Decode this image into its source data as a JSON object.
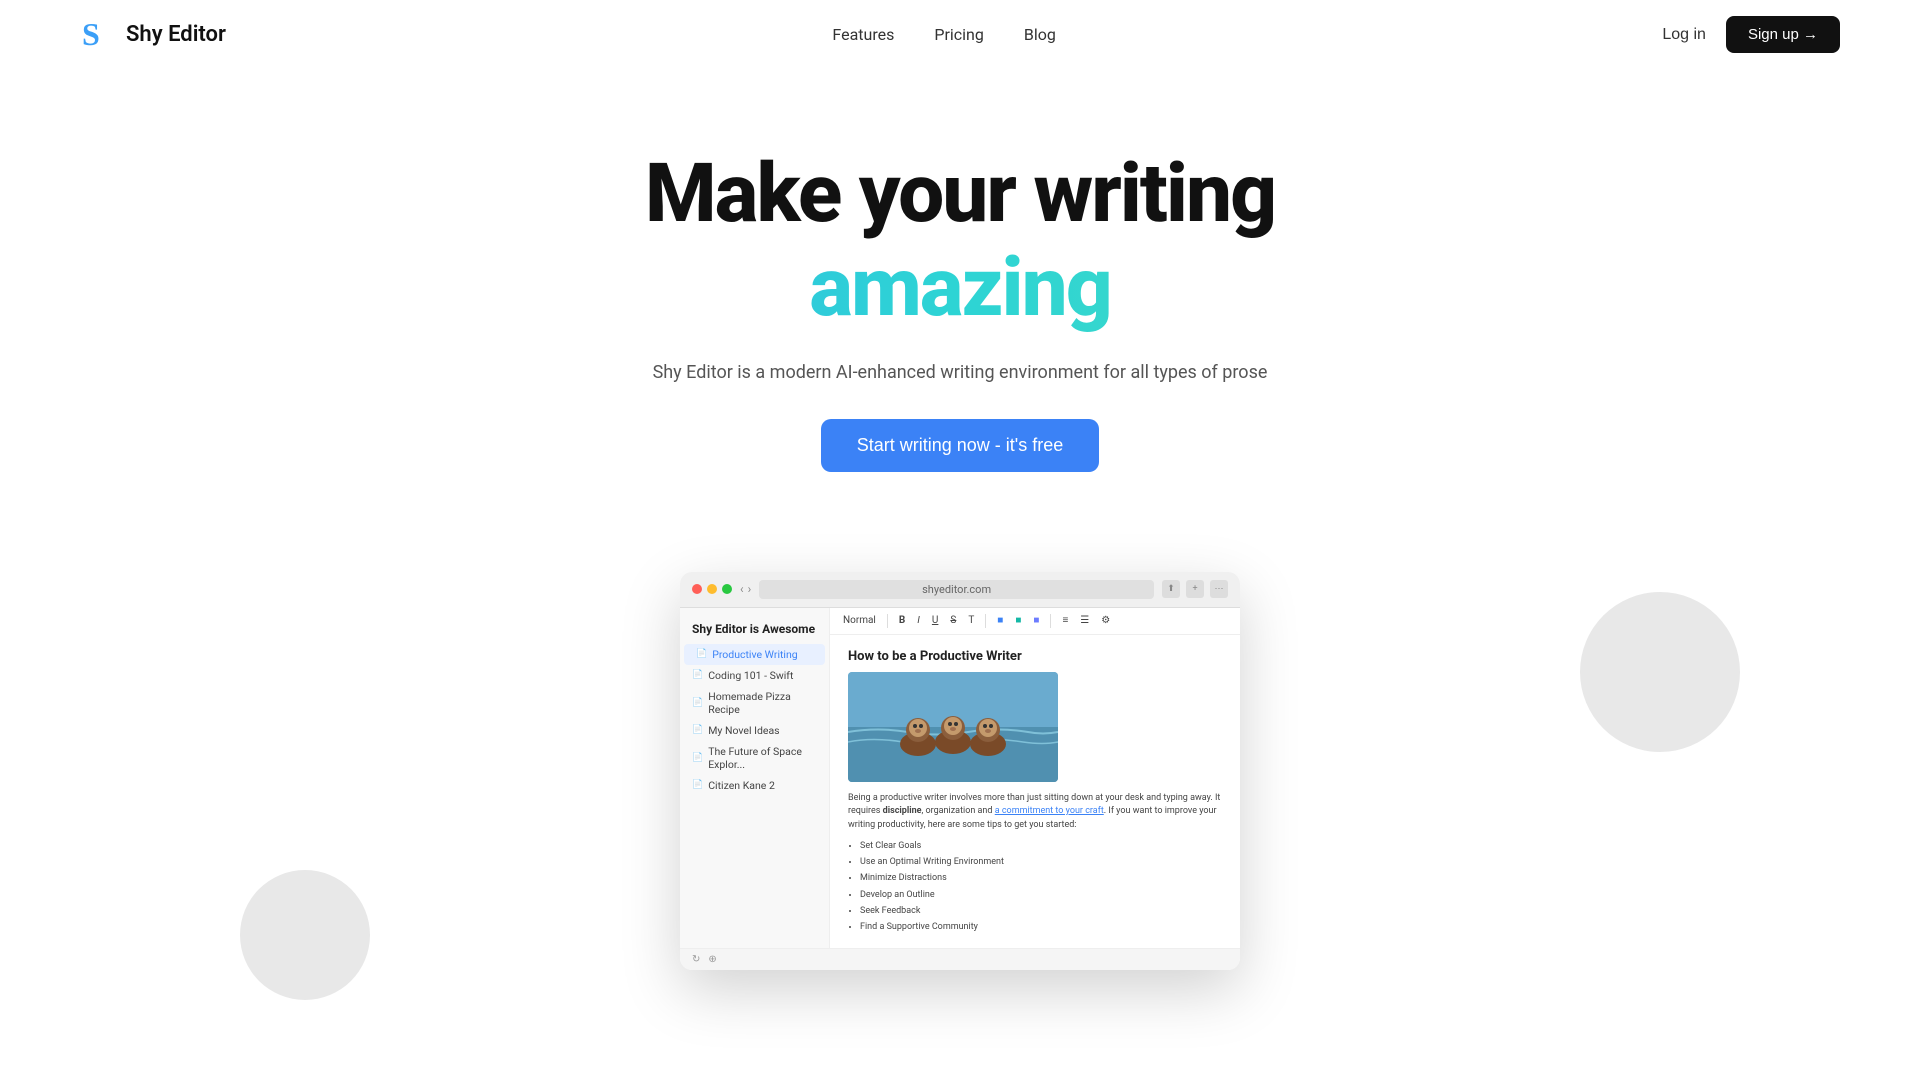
{
  "nav": {
    "logo_text": "Shy Editor",
    "logo_letter": "S",
    "links": [
      {
        "label": "Features",
        "id": "features"
      },
      {
        "label": "Pricing",
        "id": "pricing"
      },
      {
        "label": "Blog",
        "id": "blog"
      }
    ],
    "login_label": "Log in",
    "signup_label": "Sign up →"
  },
  "hero": {
    "title_line1": "Make your writing",
    "title_line2": "amazing",
    "subtitle": "Shy Editor is a modern AI-enhanced writing environment for all types of prose",
    "cta_label": "Start writing now - it's free"
  },
  "app_preview": {
    "url_bar": "shyeditor.com",
    "sidebar_title": "Shy Editor is Awesome",
    "sidebar_items": [
      {
        "label": "Productive Writing",
        "active": true
      },
      {
        "label": "Coding 101 - Swift",
        "active": false
      },
      {
        "label": "Homemade Pizza Recipe",
        "active": false
      },
      {
        "label": "My Novel Ideas",
        "active": false
      },
      {
        "label": "The Future of Space Explor...",
        "active": false
      },
      {
        "label": "Citizen Kane 2",
        "active": false
      }
    ],
    "editor": {
      "toolbar_normal": "Normal",
      "editor_title": "How to be a Productive Writer",
      "paragraph": "Being a productive writer involves more than just sitting down at your desk and typing away. It requires",
      "bold_word": "discipline",
      "link_text": "a commitment to your craft",
      "paragraph_end": ". If you want to improve your writing productivity, here are some tips to get you started:",
      "bullet_items": [
        "Set Clear Goals",
        "Use an Optimal Writing Environment",
        "Minimize Distractions",
        "Develop an Outline",
        "Seek Feedback",
        "Find a Supportive Community"
      ]
    }
  },
  "colors": {
    "accent_blue": "#3b82f6",
    "gradient_start": "#3b9ff7",
    "gradient_end": "#5bdfb0",
    "cta_bg": "#3b82f6",
    "signup_bg": "#111111"
  }
}
